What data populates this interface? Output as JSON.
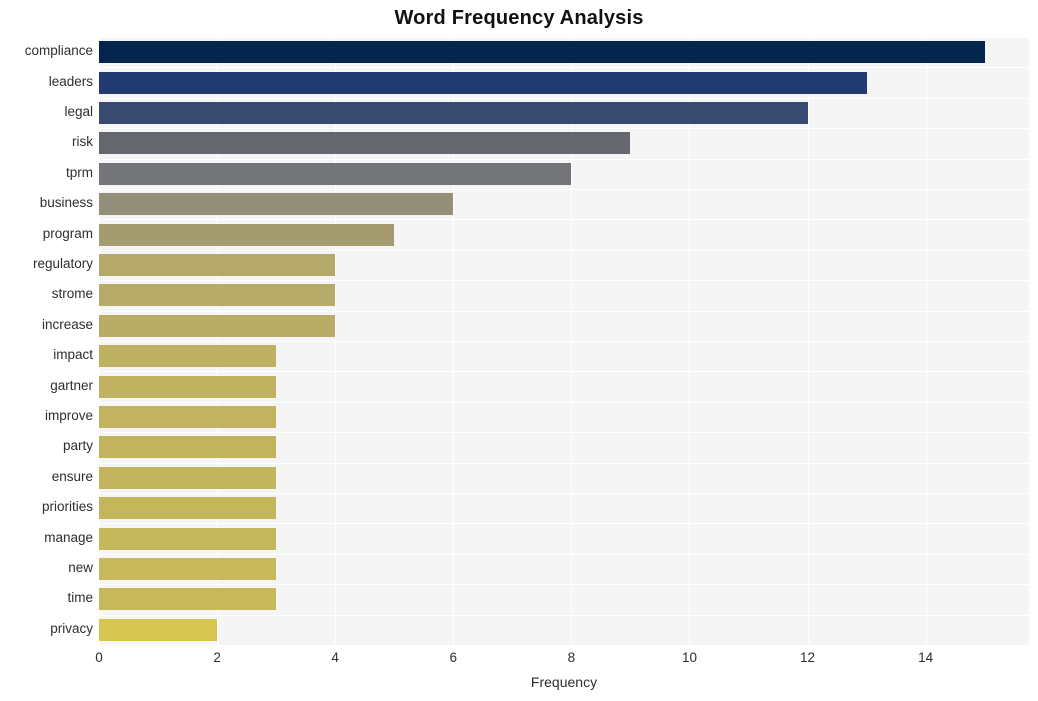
{
  "chart_data": {
    "type": "bar",
    "orientation": "horizontal",
    "title": "Word Frequency Analysis",
    "xlabel": "Frequency",
    "ylabel": "",
    "xlim": [
      0,
      15.75
    ],
    "xticks": [
      0,
      2,
      4,
      6,
      8,
      10,
      12,
      14
    ],
    "xtick_labels": [
      "0",
      "2",
      "4",
      "6",
      "8",
      "10",
      "12",
      "14"
    ],
    "grid": true,
    "legend": "none",
    "categories": [
      "compliance",
      "leaders",
      "legal",
      "risk",
      "tprm",
      "business",
      "program",
      "regulatory",
      "strome",
      "increase",
      "impact",
      "gartner",
      "improve",
      "party",
      "ensure",
      "priorities",
      "manage",
      "new",
      "time",
      "privacy"
    ],
    "values": [
      15,
      13,
      12,
      9,
      8,
      6,
      5,
      4,
      4,
      4,
      3,
      3,
      3,
      3,
      3,
      3,
      3,
      3,
      3,
      2
    ],
    "bar_colors": [
      "#04254e",
      "#213a70",
      "#384a70",
      "#65676e",
      "#747579",
      "#948f7a",
      "#a49b70",
      "#b4a969",
      "#b6ab68",
      "#b8ac67",
      "#bfb162",
      "#c0b261",
      "#c1b360",
      "#c2b45f",
      "#c3b55e",
      "#c4b65d",
      "#c5b75c",
      "#c6b85b",
      "#c7b95a",
      "#d6c64f"
    ],
    "plot_background": "#f5f5f6",
    "gridline_color": "#ffffff",
    "figure_background": "#ffffff",
    "text_color": "#2e2e2e",
    "title_color": "#111111"
  }
}
